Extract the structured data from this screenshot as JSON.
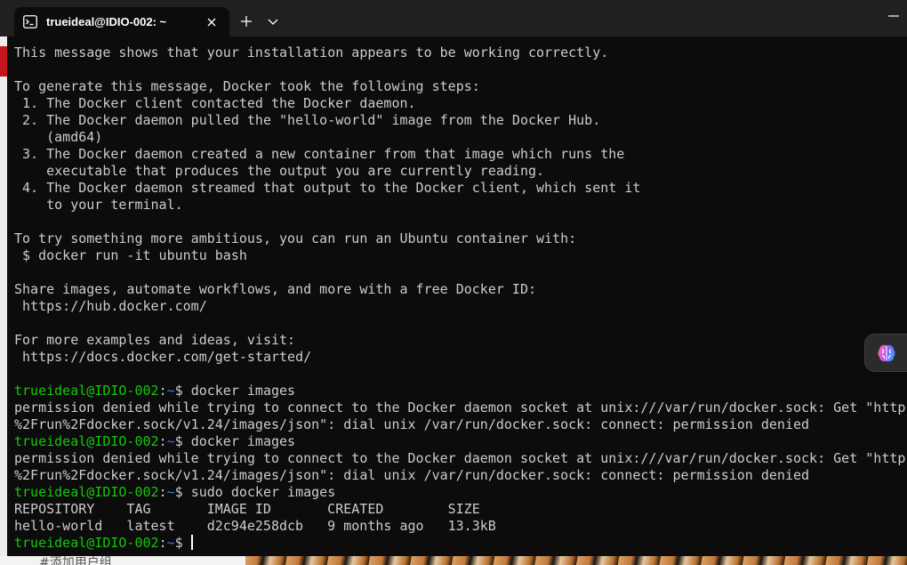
{
  "window": {
    "tab_title": "trueideal@IDIO-002: ~"
  },
  "icons": {
    "tab": "terminal-icon",
    "close": "close-icon",
    "new_tab": "plus-icon",
    "dropdown": "chevron-down-icon",
    "minimize": "minimize-icon",
    "widget": "brain-icon"
  },
  "colors": {
    "background": "#0c0c0c",
    "foreground": "#cccccc",
    "prompt_user": "#16c60c",
    "prompt_path": "#3b78ff",
    "titlebar": "#202020"
  },
  "prompt": {
    "user": "trueideal@IDIO-002",
    "separator": ":",
    "path": "~",
    "symbol": "$"
  },
  "terminal": {
    "lines": [
      "This message shows that your installation appears to be working correctly.",
      "To generate this message, Docker took the following steps:",
      " 1. The Docker client contacted the Docker daemon.",
      " 2. The Docker daemon pulled the \"hello-world\" image from the Docker Hub.",
      "    (amd64)",
      " 3. The Docker daemon created a new container from that image which runs the",
      "    executable that produces the output you are currently reading.",
      " 4. The Docker daemon streamed that output to the Docker client, which sent it",
      "    to your terminal.",
      "To try something more ambitious, you can run an Ubuntu container with:",
      " $ docker run -it ubuntu bash",
      "Share images, automate workflows, and more with a free Docker ID:",
      " https://hub.docker.com/",
      "For more examples and ideas, visit:",
      " https://docs.docker.com/get-started/"
    ],
    "sessions": [
      {
        "command": "docker images",
        "output": [
          "permission denied while trying to connect to the Docker daemon socket at unix:///var/run/docker.sock: Get \"http:",
          "%2Frun%2Fdocker.sock/v1.24/images/json\": dial unix /var/run/docker.sock: connect: permission denied"
        ]
      },
      {
        "command": "docker images",
        "output": [
          "permission denied while trying to connect to the Docker daemon socket at unix:///var/run/docker.sock: Get \"http:",
          "%2Frun%2Fdocker.sock/v1.24/images/json\": dial unix /var/run/docker.sock: connect: permission denied"
        ]
      },
      {
        "command": "sudo docker images"
      }
    ],
    "table": {
      "headers": [
        "REPOSITORY",
        "TAG",
        "IMAGE ID",
        "CREATED",
        "SIZE"
      ],
      "rows": [
        [
          "hello-world",
          "latest",
          "d2c94e258dcb",
          "9 months ago",
          "13.3kB"
        ]
      ]
    }
  },
  "background_app": {
    "bottom_text": "#添加用户组"
  }
}
